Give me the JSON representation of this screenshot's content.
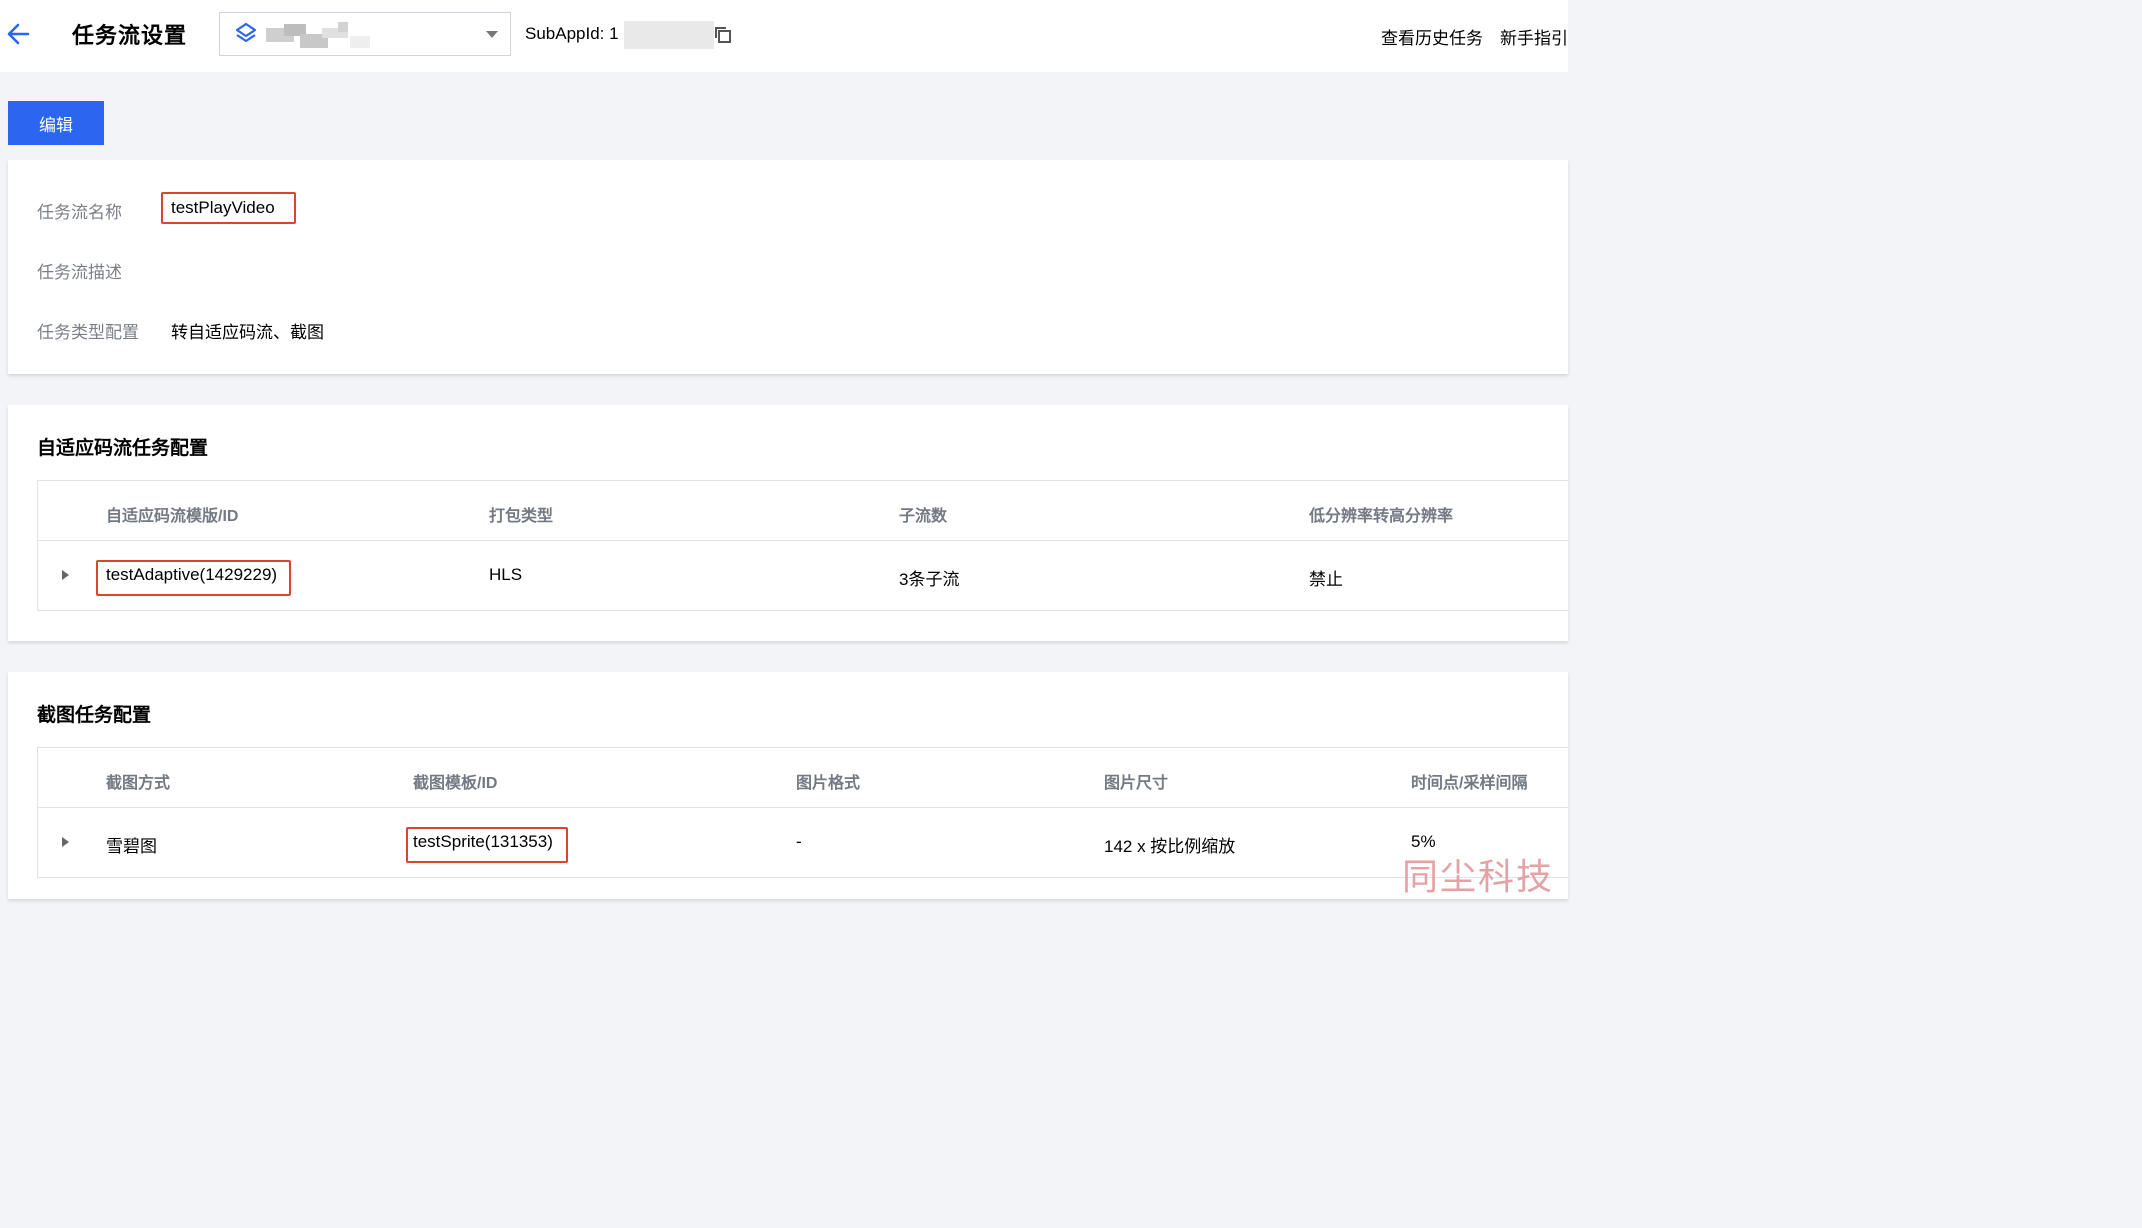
{
  "header": {
    "title": "任务流设置",
    "subapp_label": "SubAppId: 1",
    "links": [
      "查看历史任务",
      "新手指引"
    ]
  },
  "toolbar": {
    "edit_label": "编辑"
  },
  "basic_info": {
    "name_label": "任务流名称",
    "name_value": "testPlayVideo",
    "desc_label": "任务流描述",
    "desc_value": "",
    "type_label": "任务类型配置",
    "type_value": "转自适应码流、截图"
  },
  "adaptive": {
    "title": "自适应码流任务配置",
    "headers": [
      "自适应码流模版/ID",
      "打包类型",
      "子流数",
      "低分辨率转高分辨率"
    ],
    "row": [
      "testAdaptive(1429229)",
      "HLS",
      "3条子流",
      "禁止"
    ]
  },
  "snapshot": {
    "title": "截图任务配置",
    "headers": [
      "截图方式",
      "截图模板/ID",
      "图片格式",
      "图片尺寸",
      "时间点/采样间隔"
    ],
    "row": [
      "雪碧图",
      "testSprite(131353)",
      "-",
      "142 x 按比例缩放",
      "5%"
    ]
  },
  "watermark": "同尘科技",
  "colors": {
    "primary": "#2b66f0",
    "highlight": "#d8462b"
  },
  "icons": [
    "back-arrow-icon",
    "layers-icon",
    "chevron-down-icon",
    "copy-icon",
    "expand-row-icon"
  ]
}
